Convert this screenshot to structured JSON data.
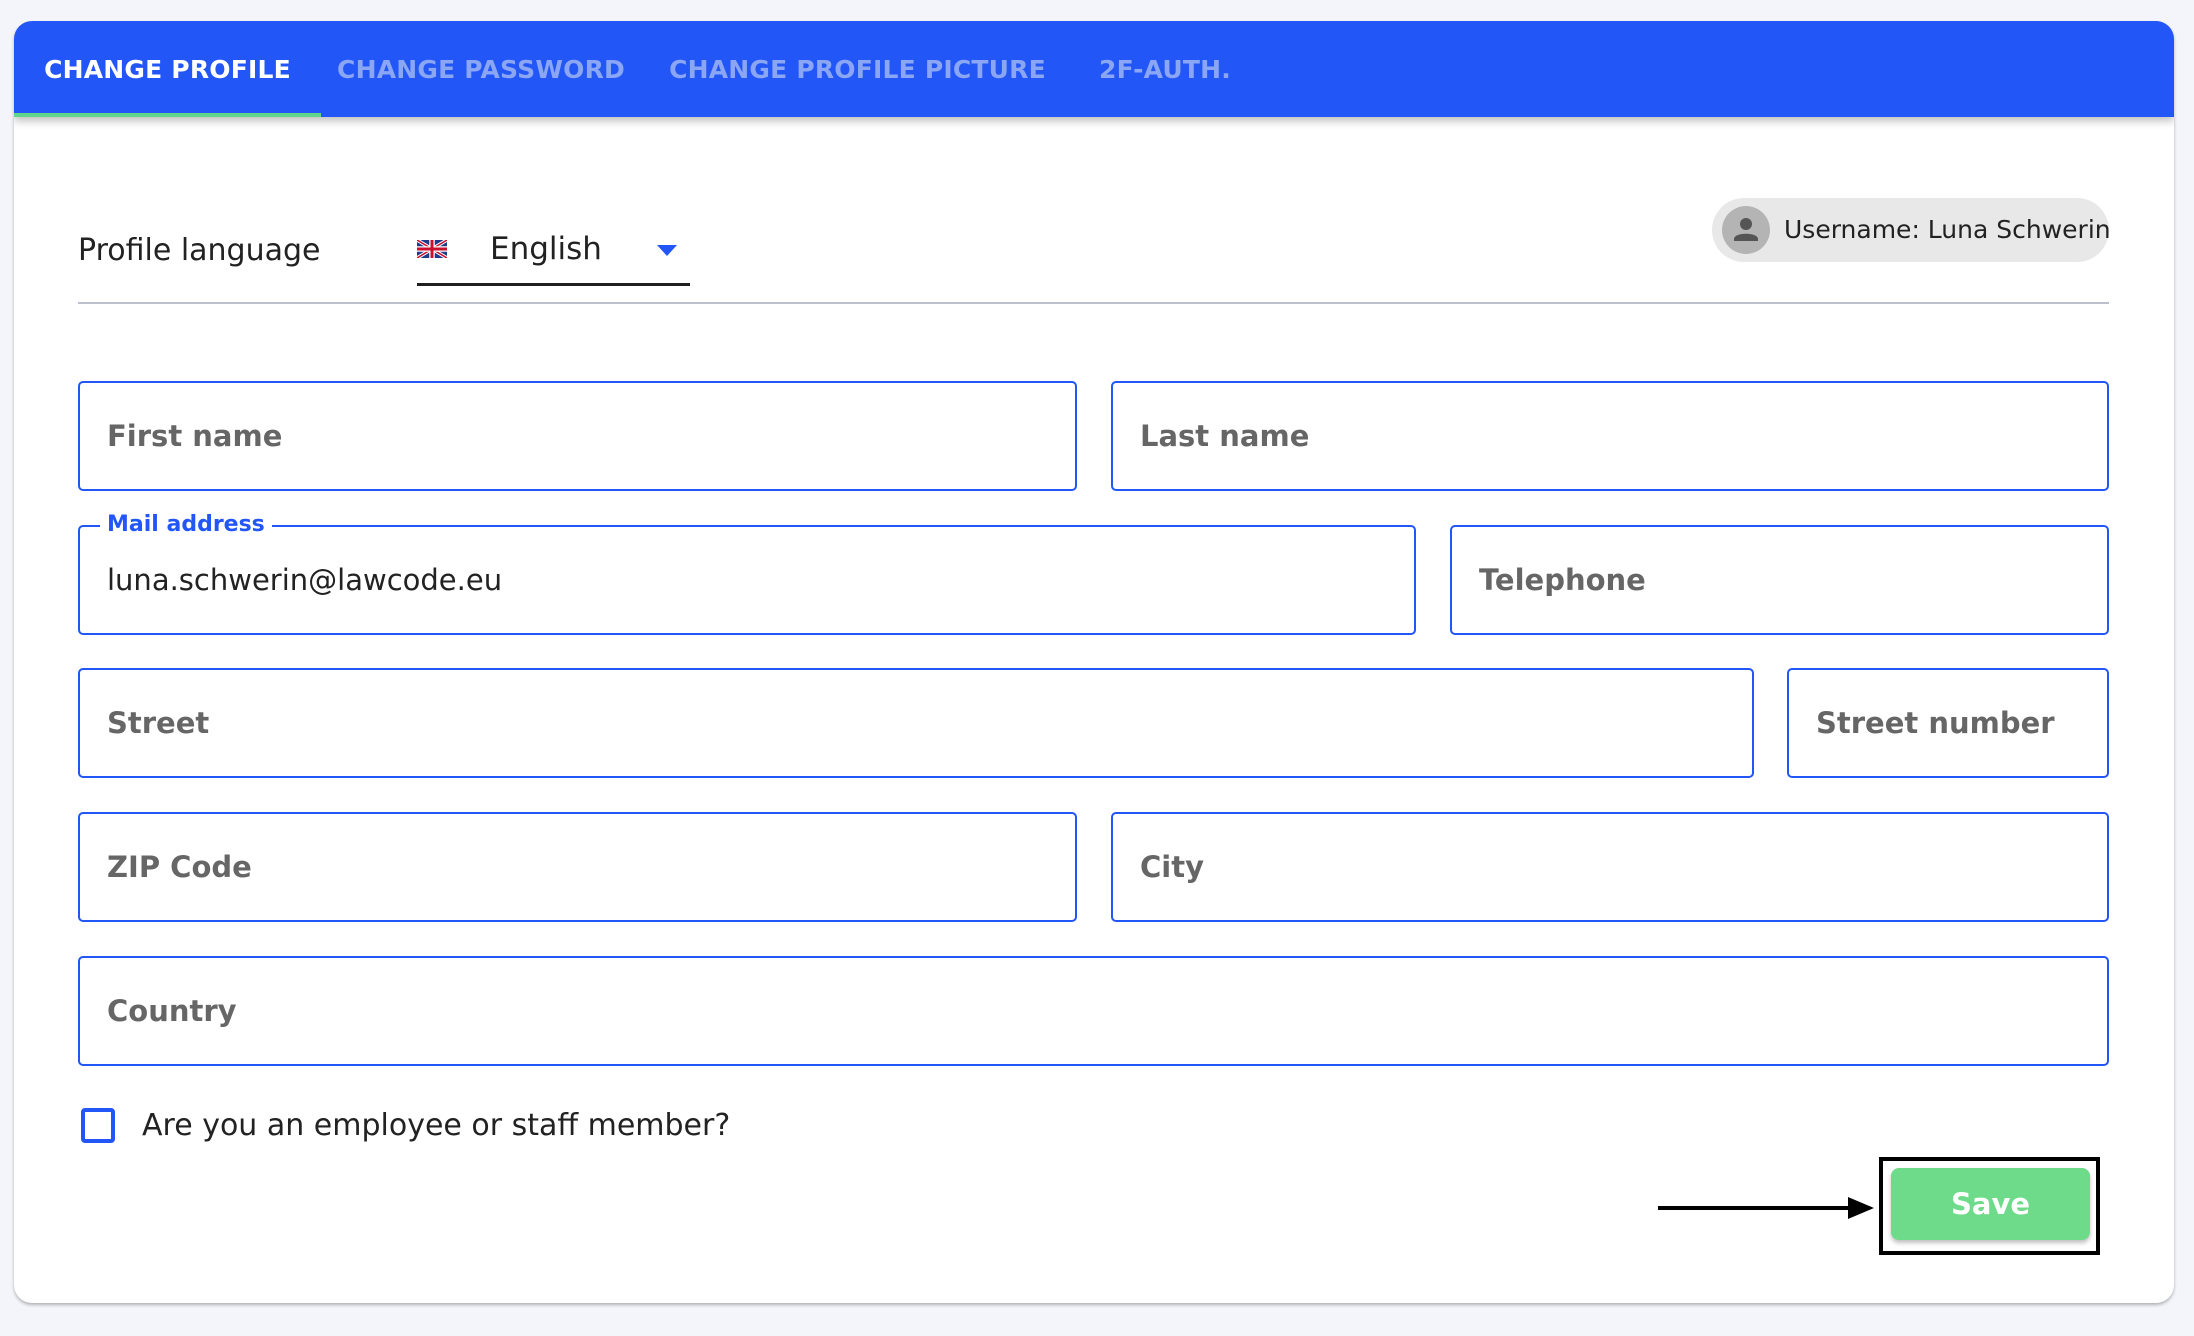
{
  "tabs": [
    {
      "label": "CHANGE PROFILE",
      "active": true
    },
    {
      "label": "CHANGE PASSWORD",
      "active": false
    },
    {
      "label": "CHANGE PROFILE PICTURE",
      "active": false
    },
    {
      "label": "2F-AUTH.",
      "active": false
    }
  ],
  "language": {
    "label": "Profile language",
    "selected": "English",
    "flag_icon": "uk-flag-icon"
  },
  "user": {
    "username_label": "Username: Luna Schwerin",
    "avatar_icon": "person-icon"
  },
  "form": {
    "first_name": {
      "placeholder": "First name",
      "value": ""
    },
    "last_name": {
      "placeholder": "Last name",
      "value": ""
    },
    "mail": {
      "label": "Mail address",
      "value": "luna.schwerin@lawcode.eu"
    },
    "telephone": {
      "placeholder": "Telephone",
      "value": ""
    },
    "street": {
      "placeholder": "Street",
      "value": ""
    },
    "street_number": {
      "placeholder": "Street number",
      "value": ""
    },
    "zip": {
      "placeholder": "ZIP Code",
      "value": ""
    },
    "city": {
      "placeholder": "City",
      "value": ""
    },
    "country": {
      "placeholder": "Country",
      "value": ""
    },
    "employee_checkbox": {
      "label": "Are you an employee or staff member?",
      "checked": false
    }
  },
  "actions": {
    "save_label": "Save"
  },
  "colors": {
    "primary": "#2356f6",
    "tab_active_indicator": "#5fd68a",
    "save_button": "#6ddb8a",
    "inactive_tab_text": "#8aa6f4"
  }
}
